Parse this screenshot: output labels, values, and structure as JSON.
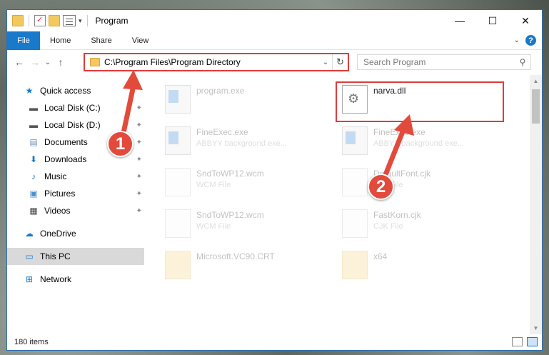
{
  "quick_access_toolbar": {
    "icons": [
      "folder-icon",
      "properties-check-icon",
      "new-folder-icon",
      "properties-icon"
    ],
    "dropdown_glyph": "▾"
  },
  "window": {
    "title": "Program",
    "buttons": {
      "minimize": "—",
      "maximize": "☐",
      "close": "✕"
    }
  },
  "ribbon": {
    "tabs": [
      {
        "label": "File"
      },
      {
        "label": "Home"
      },
      {
        "label": "Share"
      },
      {
        "label": "View"
      }
    ],
    "expand_glyph": "⌄",
    "help_glyph": "?"
  },
  "navigation": {
    "back_glyph": "←",
    "forward_glyph": "→",
    "recent_glyph": "⌄",
    "up_glyph": "↑",
    "address": "C:\\Program Files\\Program Directory",
    "address_dropdown_glyph": "⌄",
    "refresh_glyph": "↻",
    "search_placeholder": "Search Program",
    "search_glyph": "⚲"
  },
  "sidebar": {
    "quick_access": {
      "label": "Quick access",
      "icon": "star-icon"
    },
    "pinned": [
      {
        "label": "Local Disk (C:)",
        "icon": "drive-icon"
      },
      {
        "label": "Local Disk (D:)",
        "icon": "drive-icon"
      },
      {
        "label": "Documents",
        "icon": "documents-icon"
      },
      {
        "label": "Downloads",
        "icon": "download-icon"
      },
      {
        "label": "Music",
        "icon": "music-icon"
      },
      {
        "label": "Pictures",
        "icon": "pictures-icon"
      },
      {
        "label": "Videos",
        "icon": "videos-icon"
      }
    ],
    "pin_glyph": "📌",
    "onedrive": {
      "label": "OneDrive",
      "icon": "cloud-icon"
    },
    "this_pc": {
      "label": "This PC",
      "icon": "monitor-icon",
      "selected": true
    },
    "network": {
      "label": "Network",
      "icon": "network-icon"
    }
  },
  "files": [
    {
      "name": "program.exe",
      "desc": "",
      "icon": "installer-icon",
      "faded": true
    },
    {
      "name": "narva.dll",
      "desc": "",
      "icon": "gear-file-icon",
      "faded": false,
      "highlighted": true
    },
    {
      "name": "FineExec.exe",
      "desc": "ABBYY background exe...",
      "icon": "exe-icon",
      "faded": true
    },
    {
      "name": "FineExec.exe",
      "desc": "ABBYY background exe...",
      "icon": "exe-icon",
      "faded": true
    },
    {
      "name": "SndToWP12.wcm",
      "desc": "WCM File",
      "icon": "blank-file-icon",
      "faded": true
    },
    {
      "name": "DefaultFont.cjk",
      "desc": "CJK File",
      "icon": "blank-file-icon",
      "faded": true
    },
    {
      "name": "SndToWP12.wcm",
      "desc": "WCM File",
      "icon": "blank-file-icon",
      "faded": true
    },
    {
      "name": "FastKorn.cjk",
      "desc": "CJK File",
      "icon": "blank-file-icon",
      "faded": true
    },
    {
      "name": "Microsoft.VC90.CRT",
      "desc": "",
      "icon": "folder-icon",
      "faded": true
    },
    {
      "name": "x64",
      "desc": "",
      "icon": "folder-icon",
      "faded": true
    }
  ],
  "annotations": {
    "step_1": "1",
    "step_2": "2",
    "color": "#e24a3b"
  },
  "status_bar": {
    "item_count": "180 items"
  }
}
